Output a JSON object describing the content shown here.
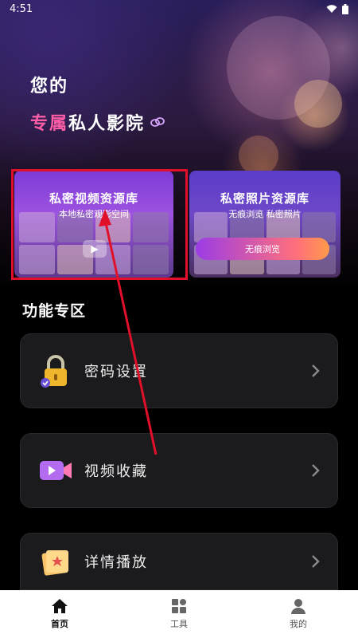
{
  "status": {
    "time": "4:51"
  },
  "hero": {
    "line1": "您的",
    "line2_accent": "专属",
    "line2_rest": "私人影院"
  },
  "cards": {
    "video": {
      "title": "私密视频资源库",
      "subtitle": "本地私密观影空间"
    },
    "photo": {
      "title": "私密照片资源库",
      "subtitle": "无痕浏览 私密照片",
      "button": "无痕浏览"
    }
  },
  "section": {
    "title": "功能专区"
  },
  "features": [
    {
      "label": "密码设置",
      "icon": "lock-icon"
    },
    {
      "label": "视频收藏",
      "icon": "video-icon"
    },
    {
      "label": "详情播放",
      "icon": "book-icon"
    }
  ],
  "tabbar": {
    "items": [
      {
        "label": "首页",
        "icon": "home-icon",
        "active": true
      },
      {
        "label": "工具",
        "icon": "tools-icon",
        "active": false
      },
      {
        "label": "我的",
        "icon": "profile-icon",
        "active": false
      }
    ]
  },
  "colors": {
    "accent": "#ff5da6",
    "highlight": "#e0102a",
    "card_bg": "#1b1b1e"
  }
}
